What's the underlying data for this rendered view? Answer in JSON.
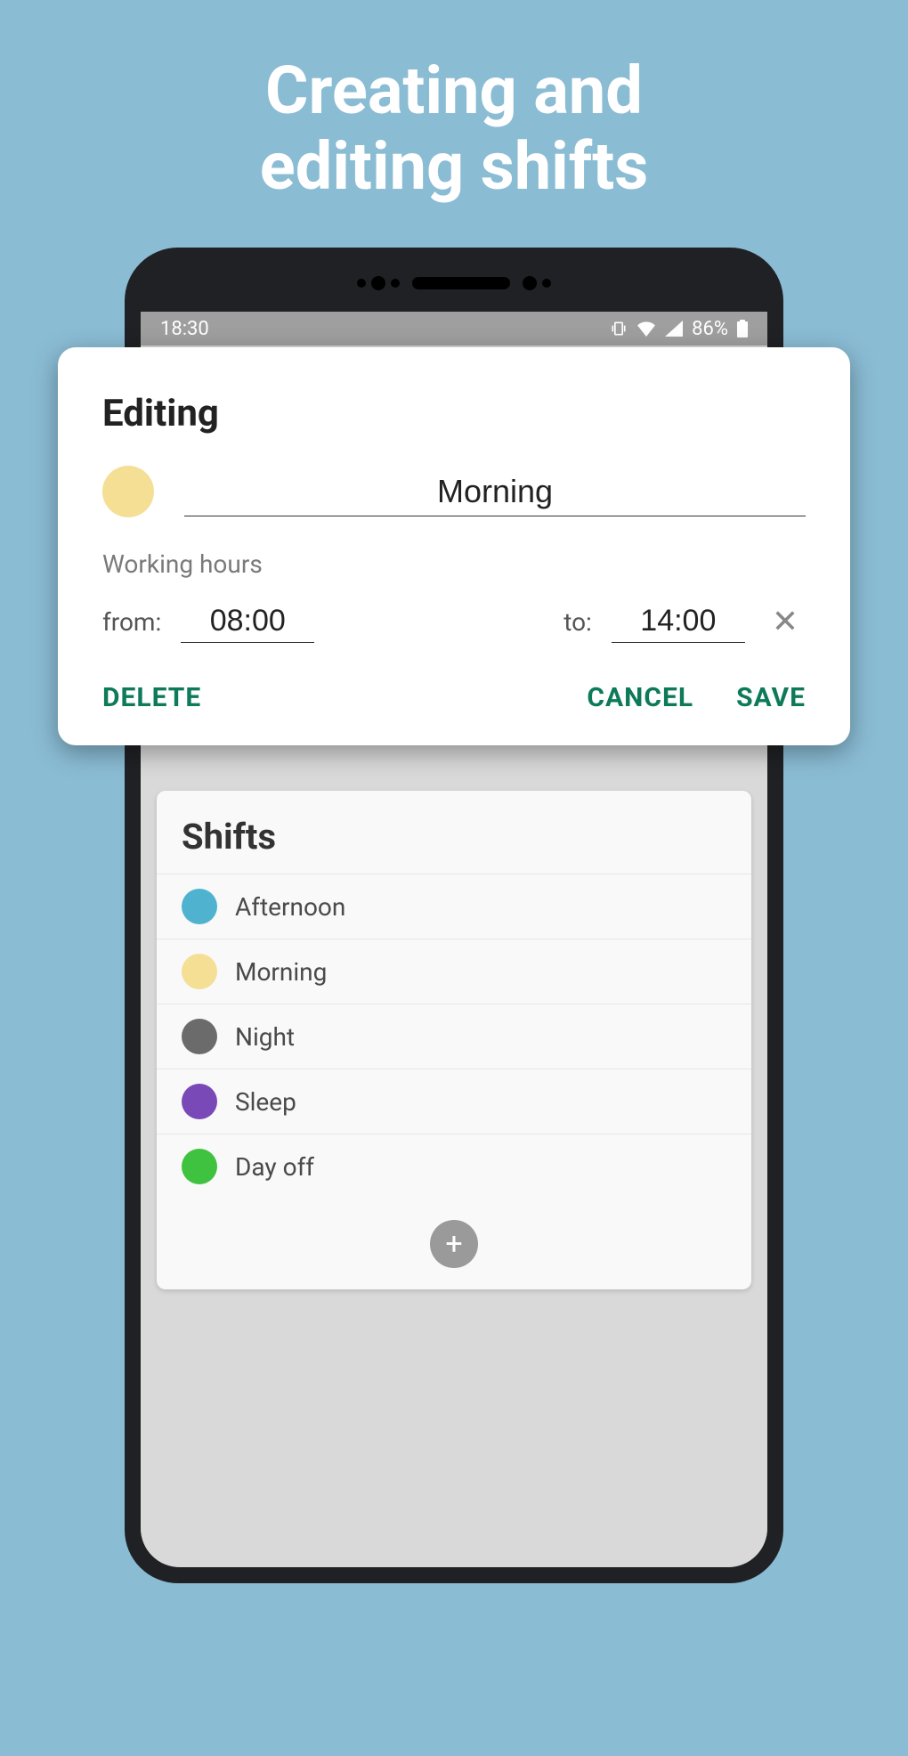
{
  "hero": {
    "line1": "Creating and",
    "line2": "editing shifts"
  },
  "statusBar": {
    "time": "18:30",
    "battery": "86%"
  },
  "dialog": {
    "title": "Editing",
    "nameValue": "Morning",
    "nameColor": "#f4df95",
    "workingHoursLabel": "Working hours",
    "fromLabel": "from:",
    "fromValue": "08:00",
    "toLabel": "to:",
    "toValue": "14:00",
    "deleteLabel": "DELETE",
    "cancelLabel": "CANCEL",
    "saveLabel": "SAVE"
  },
  "shiftsCard": {
    "title": "Shifts",
    "items": [
      {
        "label": "Afternoon",
        "color": "#4fb3cf"
      },
      {
        "label": "Morning",
        "color": "#f4df95"
      },
      {
        "label": "Night",
        "color": "#6b6b6b"
      },
      {
        "label": "Sleep",
        "color": "#7a49b8"
      },
      {
        "label": "Day off",
        "color": "#3fc23f"
      }
    ]
  }
}
